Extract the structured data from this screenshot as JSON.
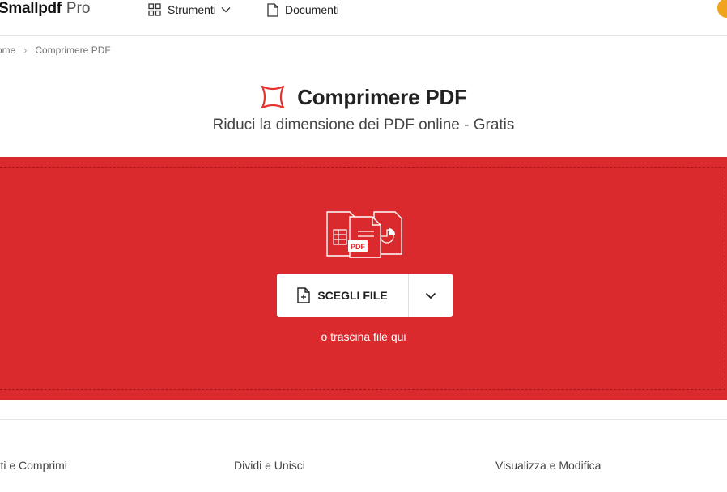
{
  "header": {
    "logo_main": "Smallpdf",
    "logo_pro": "Pro",
    "nav": {
      "tools_label": "Strumenti",
      "docs_label": "Documenti"
    },
    "icons": [
      "grid-icon",
      "chevron-down-icon",
      "document-icon"
    ]
  },
  "breadcrumb": {
    "home": "ome",
    "separator": "›",
    "current": "Comprimere PDF"
  },
  "page": {
    "title": "Comprimere PDF",
    "subtitle": "Riduci la dimensione dei PDF online - Gratis"
  },
  "dropzone": {
    "choose_label": "SCEGLI FILE",
    "hint": "o trascina file qui",
    "background_color": "#db2a2e",
    "file_badge": "PDF"
  },
  "categories": [
    {
      "label": "erti e Comprimi"
    },
    {
      "label": "Dividi e Unisci"
    },
    {
      "label": "Visualizza e Modifica"
    }
  ],
  "colors": {
    "brand_red": "#db2a2e",
    "avatar": "#f0a31c"
  }
}
